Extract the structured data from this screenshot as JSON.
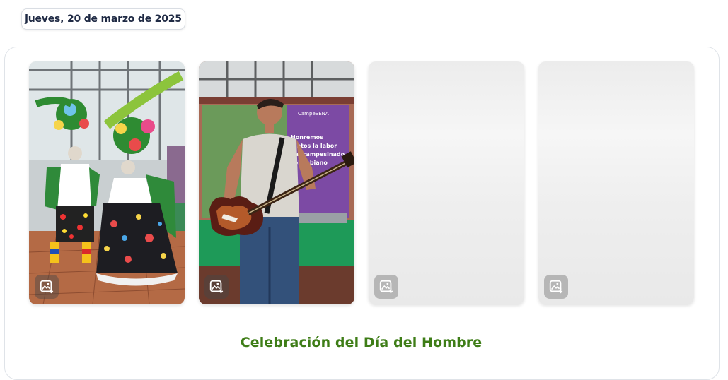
{
  "header": {
    "date_label": "jueves, 20 de marzo de 2025"
  },
  "gallery": {
    "photos": [
      {
        "id": 1,
        "loaded": true,
        "icon": "image-download-icon"
      },
      {
        "id": 2,
        "loaded": true,
        "icon": "image-download-icon"
      },
      {
        "id": 3,
        "loaded": false,
        "icon": "image-download-icon"
      },
      {
        "id": 4,
        "loaded": false,
        "icon": "image-download-icon"
      }
    ],
    "poster_text": {
      "brand": "CampeSENA",
      "line1": "Honremos",
      "line2": "juntos la labor",
      "line3": "del campesinado",
      "line4": "colombiano"
    }
  },
  "event": {
    "title": "Celebración del Día del Hombre"
  },
  "colors": {
    "title_green": "#3e7d17",
    "chip_text": "#1f2a44",
    "card_border": "#dfe3e8"
  }
}
